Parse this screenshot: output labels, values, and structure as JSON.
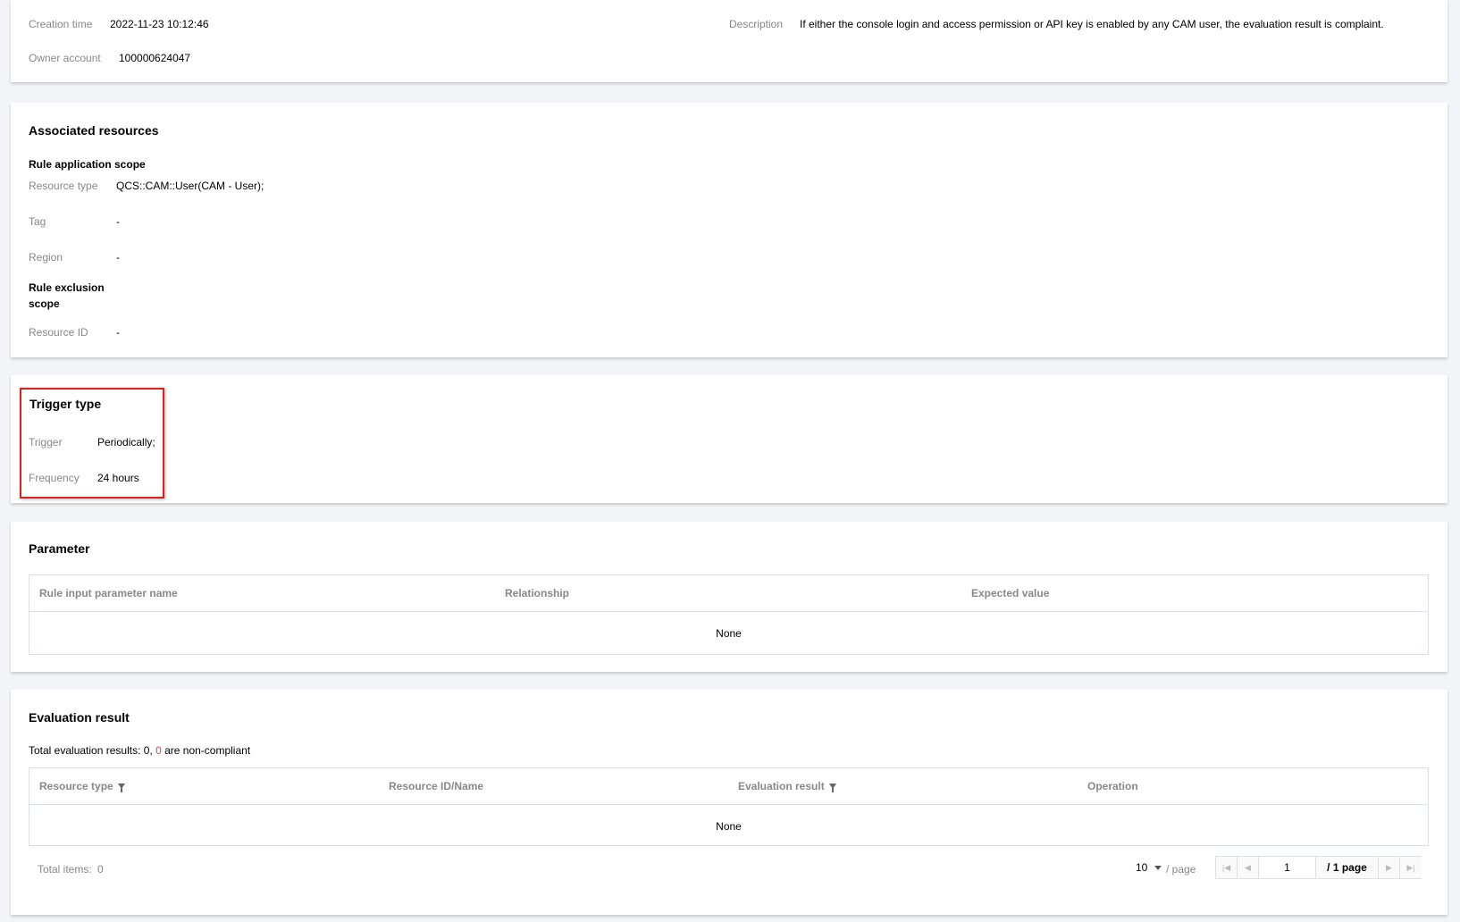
{
  "basic": {
    "creation_time_label": "Creation time",
    "creation_time": "2022-11-23 10:12:46",
    "owner_account_label": "Owner account",
    "owner_account": "100000624047",
    "description_label": "Description",
    "description": "If either the console login and access permission or API key is enabled by any CAM user, the evaluation result is complaint."
  },
  "associated": {
    "title": "Associated resources",
    "scope_title": "Rule application scope",
    "resource_type_label": "Resource type",
    "resource_type": "QCS::CAM::User(CAM - User);",
    "tag_label": "Tag",
    "tag": "-",
    "region_label": "Region",
    "region": "-",
    "exclusion_title_1": "Rule exclusion",
    "exclusion_title_2": "scope",
    "resource_id_label": "Resource ID",
    "resource_id": "-"
  },
  "trigger": {
    "title": "Trigger type",
    "trigger_label": "Trigger",
    "trigger": "Periodically;",
    "frequency_label": "Frequency",
    "frequency": "24 hours",
    "highlight_color": "#e02020"
  },
  "parameter": {
    "title": "Parameter",
    "columns": [
      "Rule input parameter name",
      "Relationship",
      "Expected value"
    ],
    "empty": "None"
  },
  "evaluation": {
    "title": "Evaluation result",
    "summary_prefix": "Total evaluation results: 0, ",
    "summary_count": "0",
    "summary_suffix": " are non-compliant",
    "columns": [
      "Resource type",
      "Resource ID/Name",
      "Evaluation result",
      "Operation"
    ],
    "empty": "None",
    "total_items_label": "Total items:",
    "total_items": "0",
    "page_size": "10",
    "per_page_label": "/ page",
    "current_page": "1",
    "page_total": "/ 1 page",
    "noncompliant_color": "#e54545"
  }
}
